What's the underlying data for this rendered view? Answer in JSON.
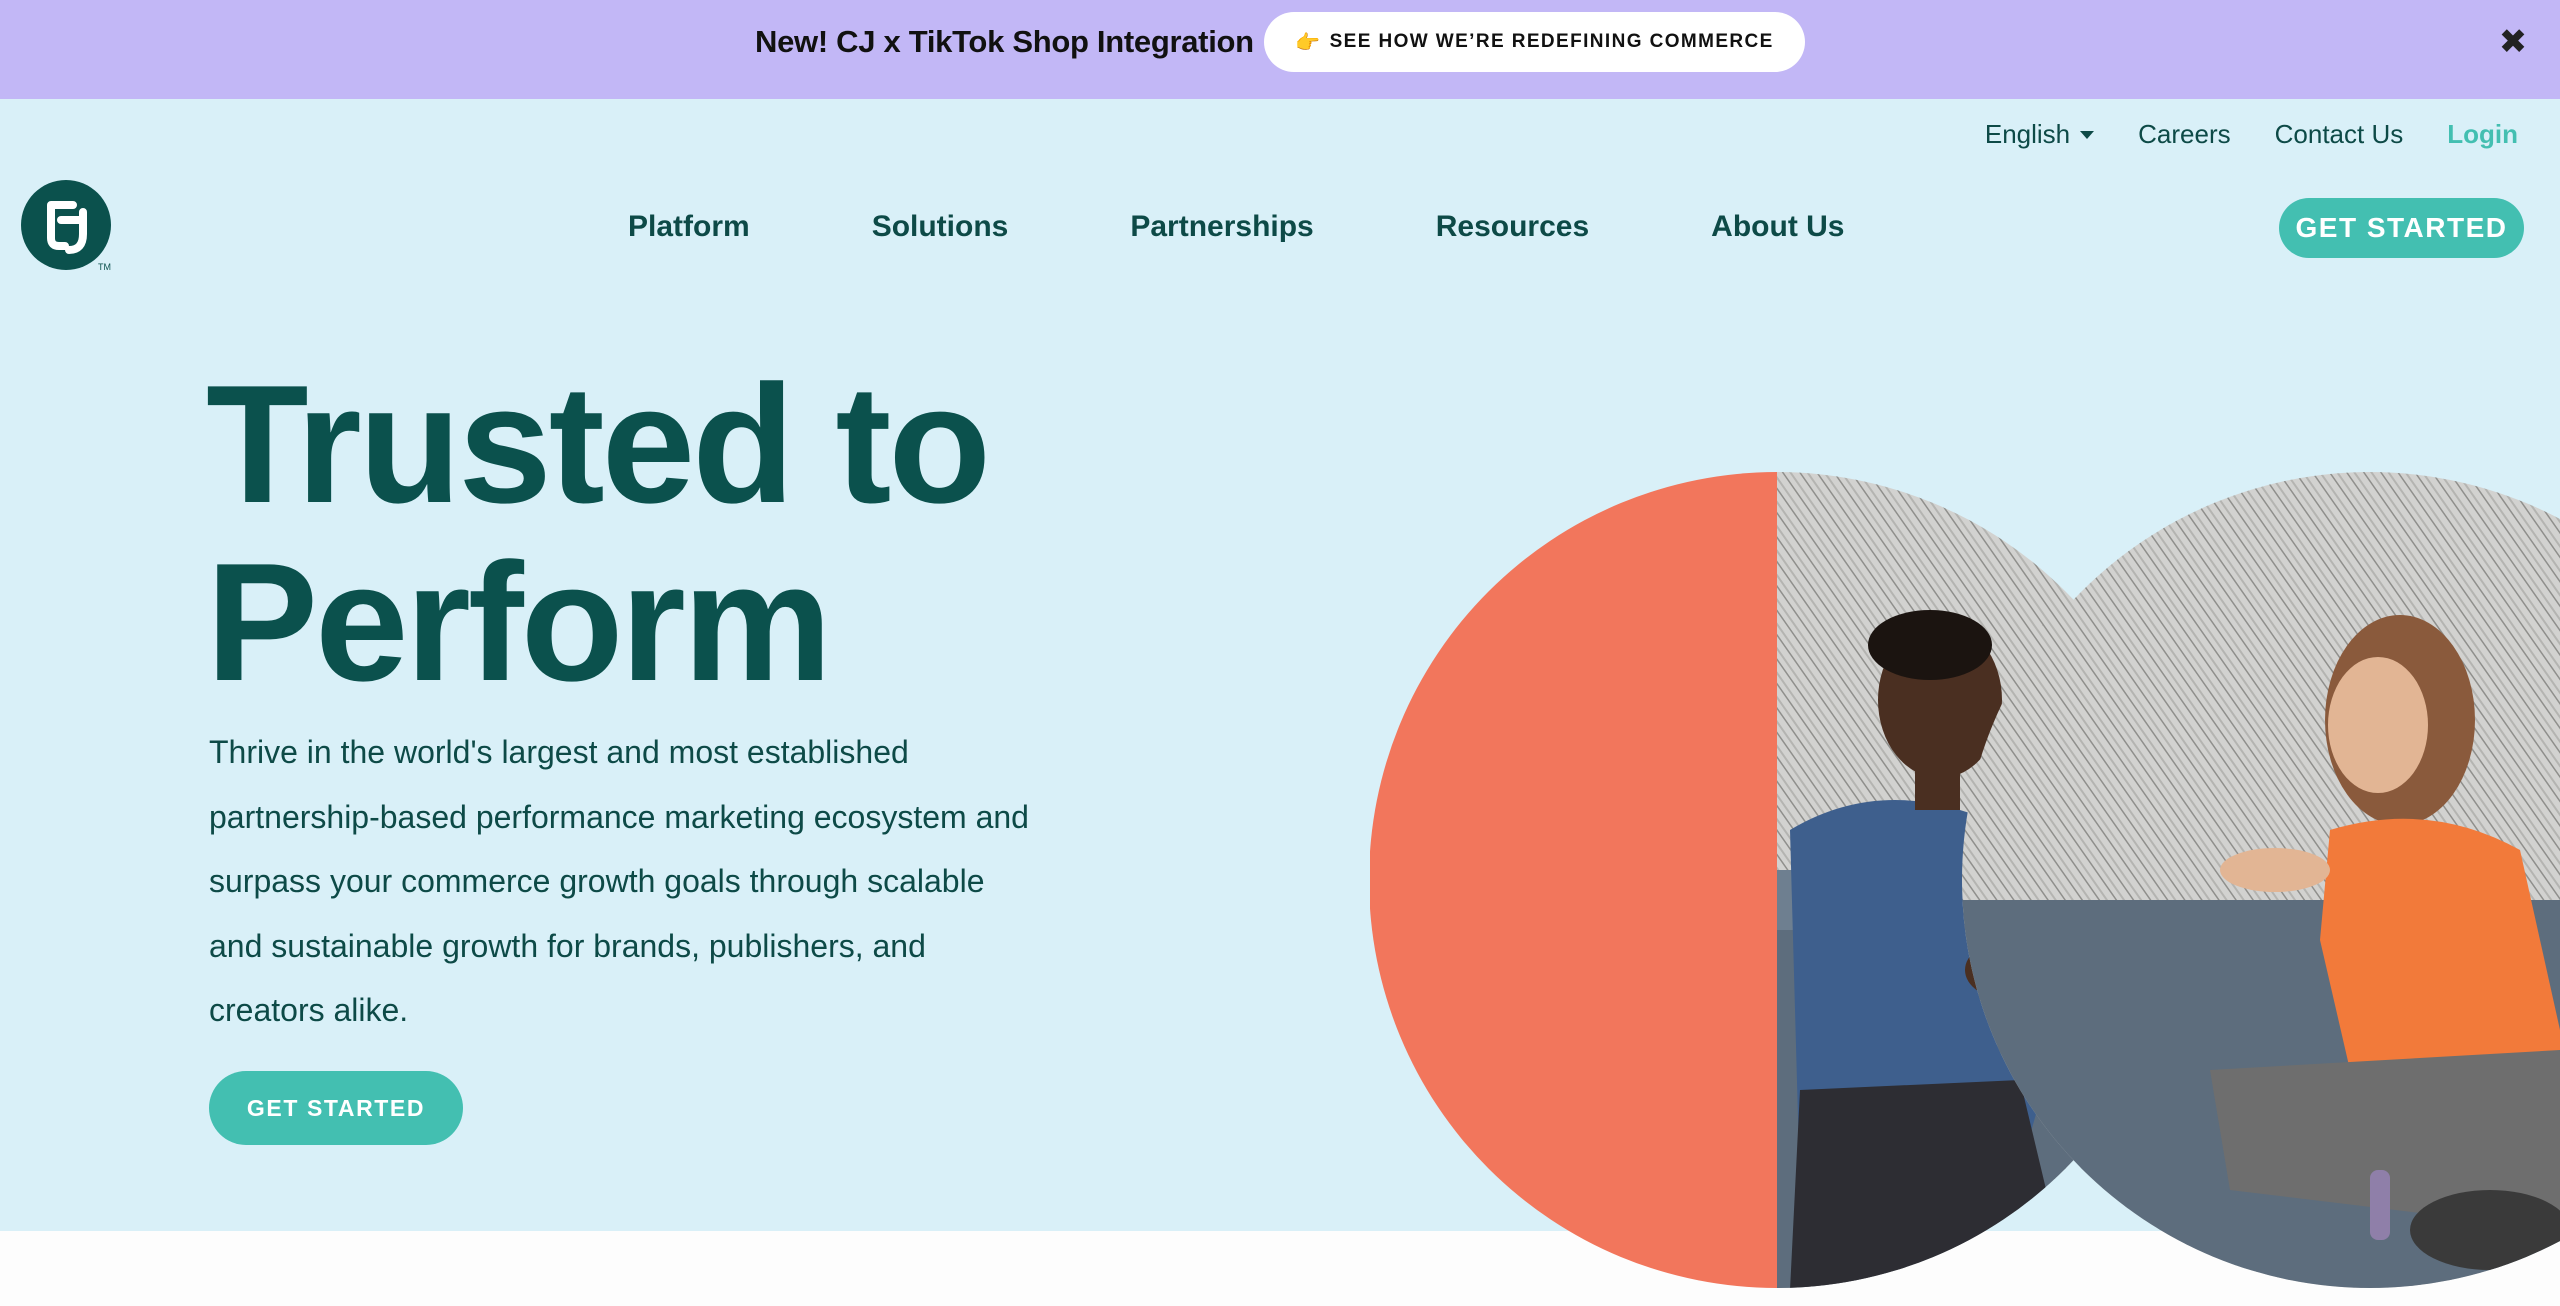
{
  "promo": {
    "headline": "New! CJ x TikTok Shop Integration",
    "cta_emoji": "👉",
    "cta_label": "SEE HOW WE’RE REDEFINING COMMERCE",
    "close_symbol": "✖"
  },
  "utility_nav": {
    "language": "English",
    "careers": "Careers",
    "contact": "Contact Us",
    "login": "Login"
  },
  "logo": {
    "alt": "CJ logo",
    "trademark": "TM"
  },
  "main_nav": {
    "items": [
      "Platform",
      "Solutions",
      "Partnerships",
      "Resources",
      "About Us"
    ],
    "cta": "GET STARTED"
  },
  "hero": {
    "title_line1": "Trusted to",
    "title_line2": "Perform",
    "body": "Thrive in the world's largest and most established partnership-based performance marketing ecosystem and surpass your commerce growth goals through scalable and sustainable growth for brands, publishers, and creators alike.",
    "cta": "GET STARTED"
  },
  "colors": {
    "promo_bg": "#c2b7f6",
    "hero_bg": "#d9f0f8",
    "brand_dark": "#0b514d",
    "accent_teal": "#43bfb1",
    "coral": "#f2765c",
    "login_teal": "#43bfb1"
  }
}
